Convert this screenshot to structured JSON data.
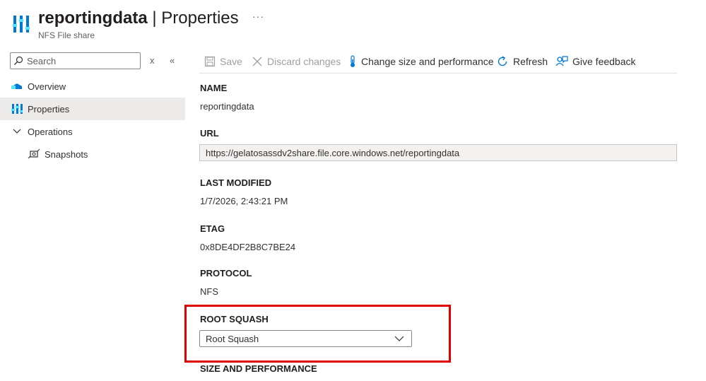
{
  "header": {
    "title": "reportingdata",
    "separator": "|",
    "page": "Properties",
    "more": "···",
    "subtitle": "NFS File share"
  },
  "sidebar": {
    "search_placeholder": "Search",
    "clear_btn": "x",
    "collapse_btn": "«",
    "items": [
      {
        "label": "Overview",
        "icon": "overview-icon"
      },
      {
        "label": "Properties",
        "icon": "properties-icon",
        "active": true
      },
      {
        "label": "Operations",
        "icon": "chevron-down-icon"
      },
      {
        "label": "Snapshots",
        "icon": "snapshot-icon"
      }
    ]
  },
  "toolbar": {
    "save": "Save",
    "discard": "Discard changes",
    "change_size": "Change size and performance",
    "refresh": "Refresh",
    "feedback": "Give feedback"
  },
  "properties": {
    "name_label": "NAME",
    "name_value": "reportingdata",
    "url_label": "URL",
    "url_value": "https://gelatosassdv2share.file.core.windows.net/reportingdata",
    "last_modified_label": "LAST MODIFIED",
    "last_modified_value": "1/7/2026, 2:43:21 PM",
    "etag_label": "ETAG",
    "etag_value": "0x8DE4DF2B8C7BE24",
    "protocol_label": "PROTOCOL",
    "protocol_value": "NFS",
    "root_squash_label": "ROOT SQUASH",
    "root_squash_value": "Root Squash",
    "size_label": "SIZE AND PERFORMANCE"
  },
  "colors": {
    "accent": "#0078d4",
    "highlight_border": "#e00000"
  }
}
